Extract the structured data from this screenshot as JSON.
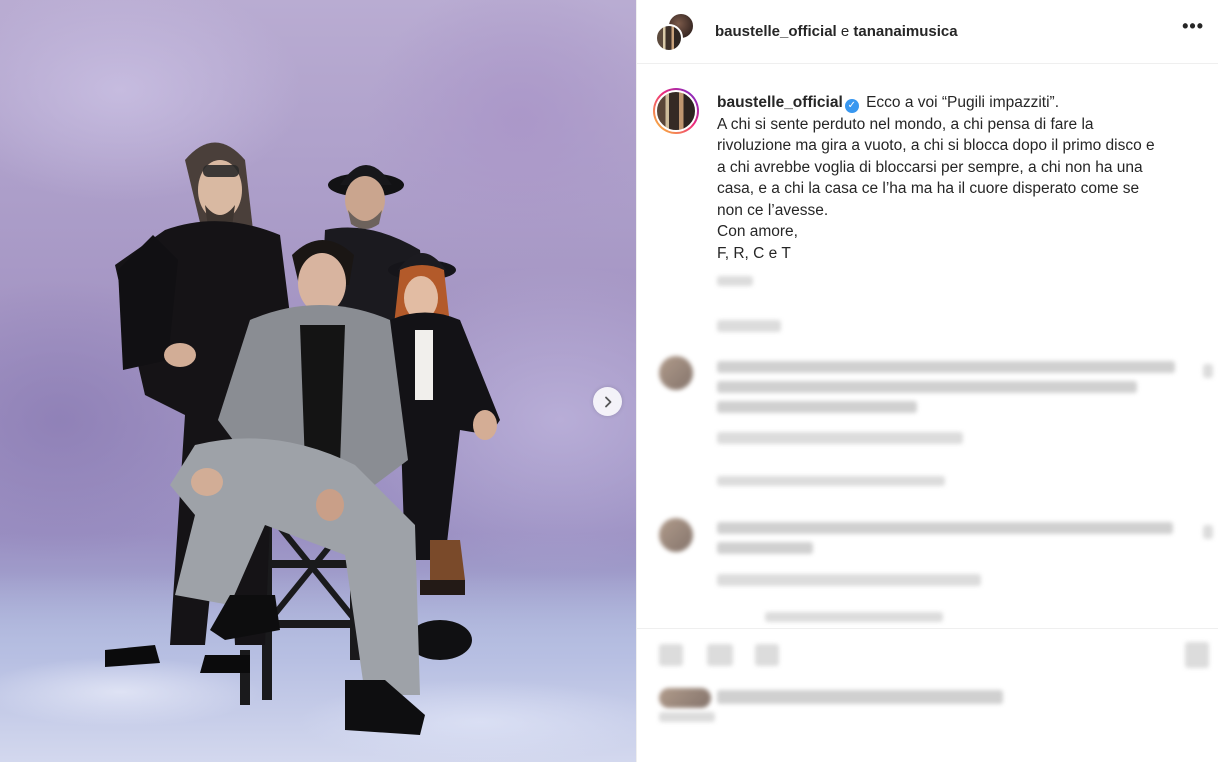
{
  "post": {
    "header": {
      "author": "baustelle_official",
      "conjunction": "e",
      "coauthor": "tananaimusica",
      "more_icon": "more-horizontal-icon",
      "more_label": "•••"
    },
    "caption": {
      "username": "baustelle_official",
      "verified_icon": "verified-badge-icon",
      "verified_mark": "✓",
      "lines": [
        "Ecco a voi “Pugili impazziti”.",
        "A chi si sente perduto nel mondo, a chi pensa di fare la",
        "rivoluzione ma gira a vuoto, a chi si blocca dopo il primo disco e",
        "a chi avrebbe voglia di bloccarsi per sempre, a chi non ha una",
        "casa, e a chi la casa ce l’ha ma ha il cuore disperato come se",
        "non ce l’avesse.",
        "Con amore,",
        "F, R, C e T"
      ]
    },
    "carousel": {
      "next_icon": "chevron-right-icon"
    }
  },
  "colors": {
    "text": "#262626",
    "verified": "#3897f0",
    "divider": "#efefef"
  }
}
